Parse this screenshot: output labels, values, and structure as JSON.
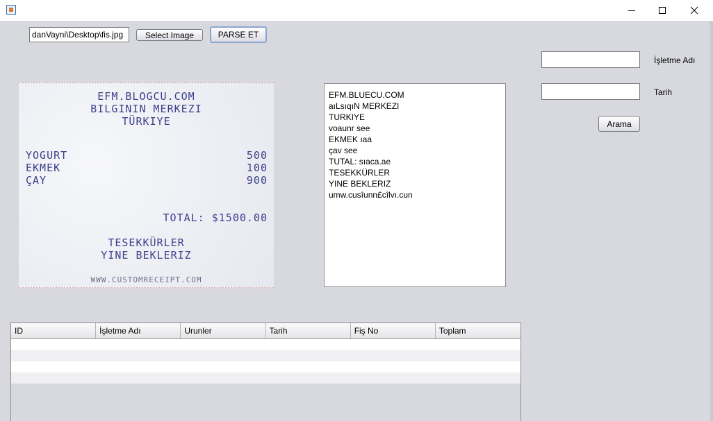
{
  "window": {
    "icon": "java-cup-icon",
    "controls": [
      "minimize-icon",
      "maximize-icon",
      "close-icon"
    ]
  },
  "toolbar": {
    "path_value": "danVayni\\Desktop\\fis.jpg",
    "select_image_label": "Select Image",
    "parse_label": "PARSE ET"
  },
  "receipt": {
    "header": [
      "EFM.BLOGCU.COM",
      "BILGININ MERKEZI",
      "TÜRKIYE"
    ],
    "items": [
      {
        "name": "YOGURT",
        "price": "500"
      },
      {
        "name": "EKMEK",
        "price": "100"
      },
      {
        "name": "ÇAY",
        "price": "900"
      }
    ],
    "total": "TOTAL: $1500.00",
    "thanks": [
      "TESEKKÜRLER",
      "YINE BEKLERIZ"
    ],
    "footer": "WWW.CUSTOMRECEIPT.COM"
  },
  "ocr_output": [
    "EFM.BLUECU.COM",
    "aıLsıqıN MERKEZI",
    "TURKIYE",
    "voaunr see",
    "EKMEK ıaa",
    "çav see",
    "TUTAL: sıaca.ae",
    "TESEKKÜRLER",
    "YINE BEKLERIZ",
    "umw.cusîunn£cîlvı.cun"
  ],
  "search": {
    "business_name_label": "İşletme Adı",
    "business_name_value": "",
    "date_label": "Tarih",
    "date_value": "",
    "search_button_label": "Arama"
  },
  "table": {
    "columns": [
      "ID",
      "İşletme Adı",
      "Urunler",
      "Tarih",
      "Fiş No",
      "Toplam"
    ],
    "rows": []
  }
}
